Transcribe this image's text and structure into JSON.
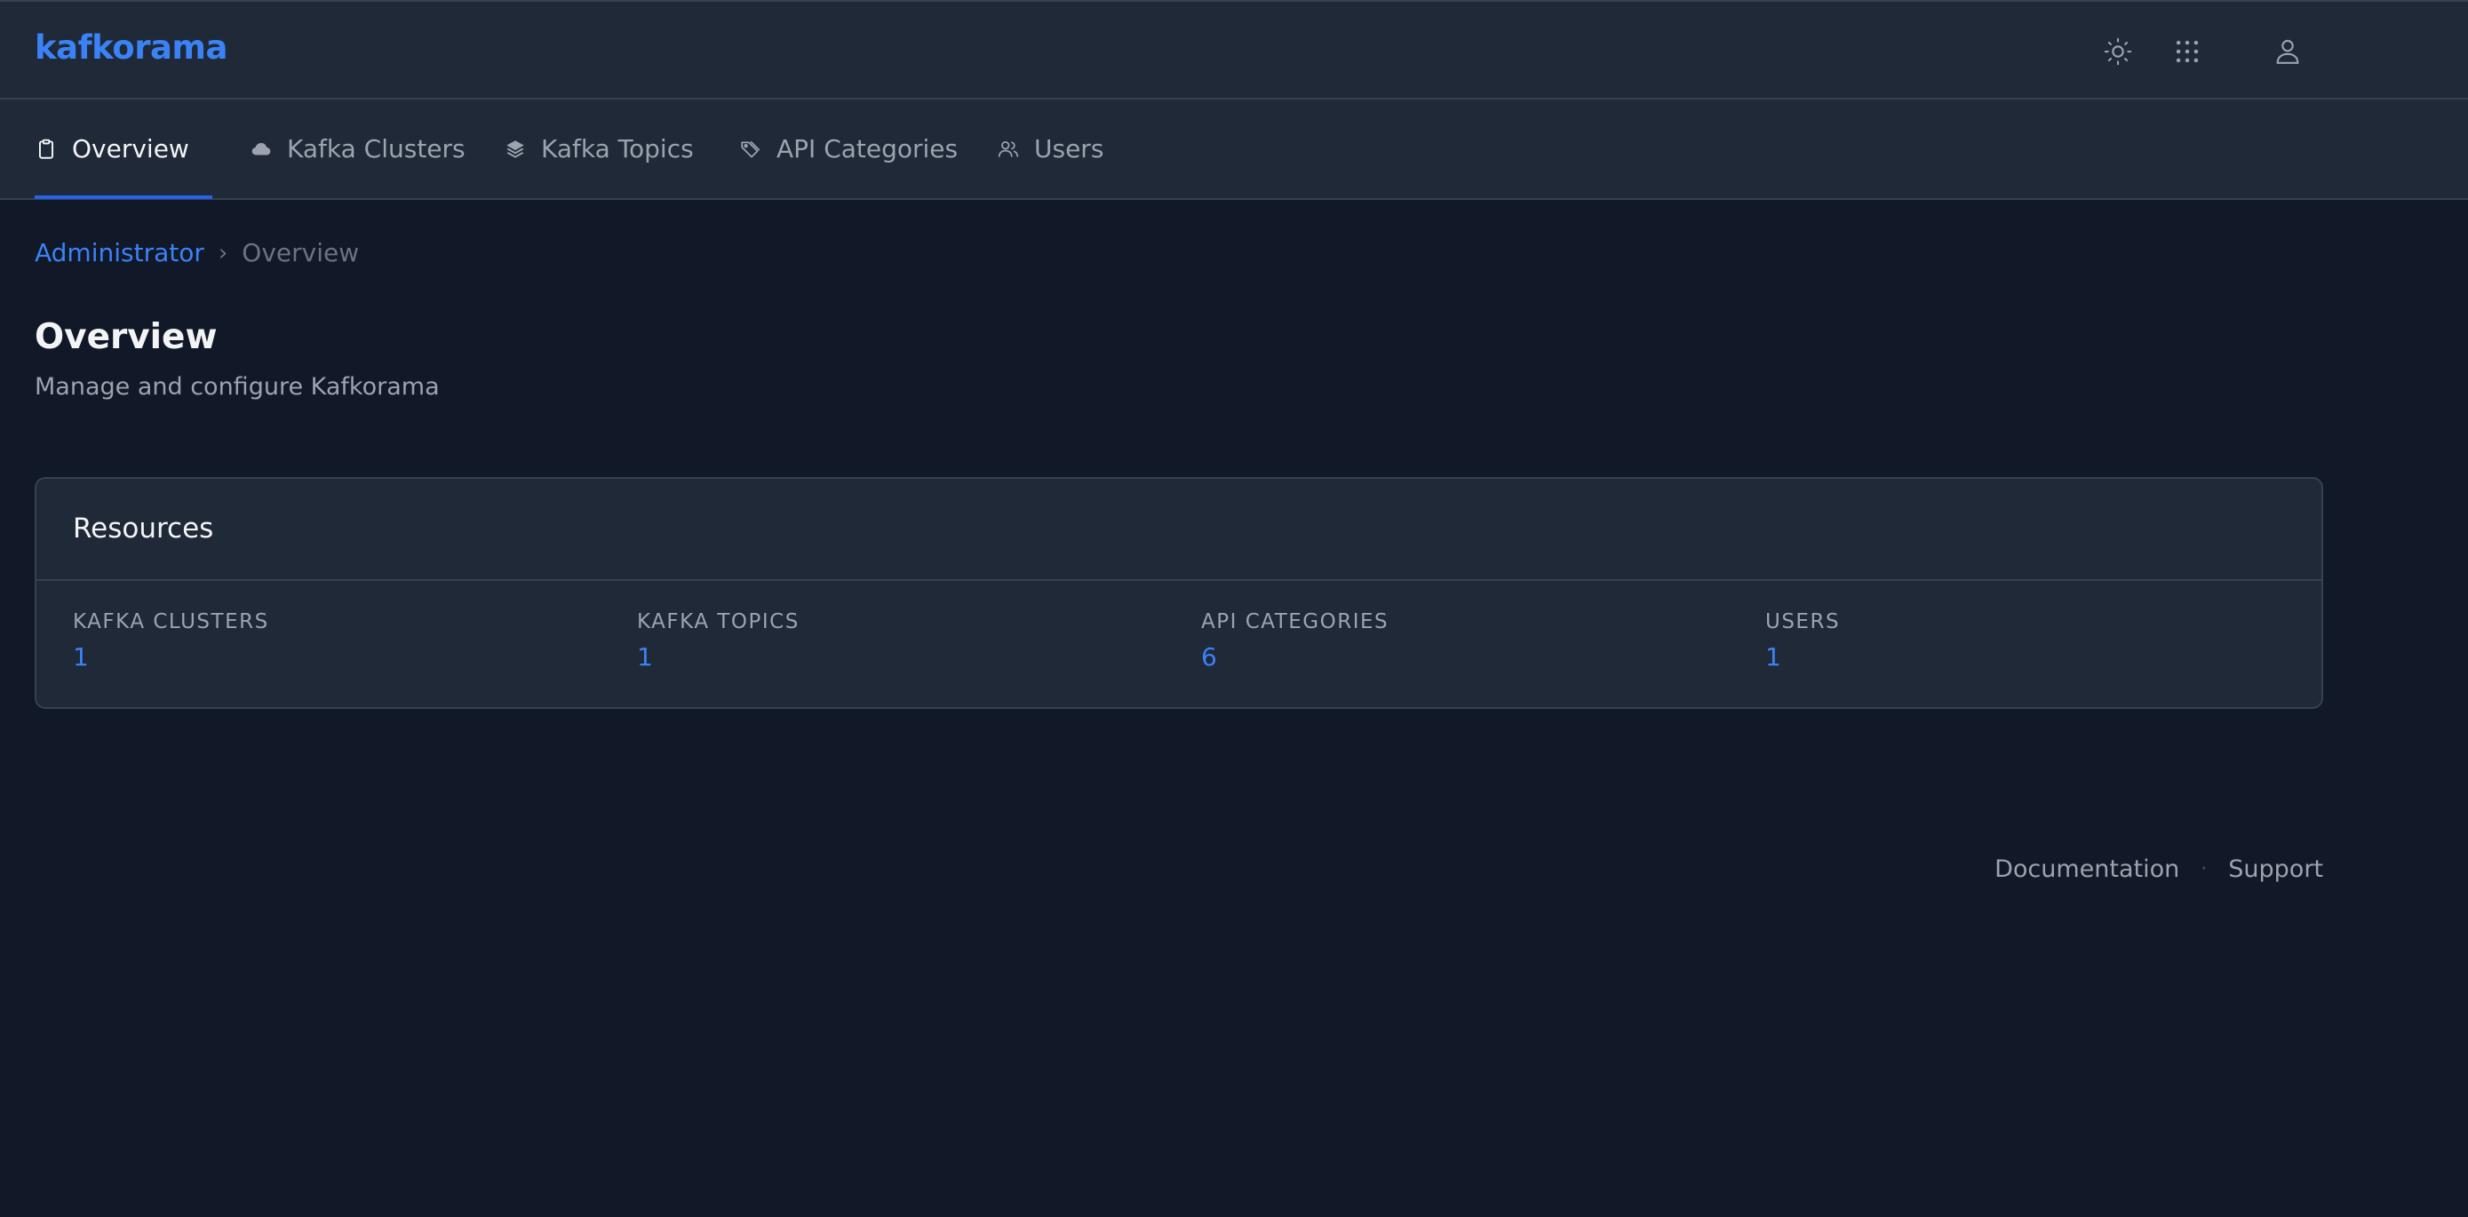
{
  "app": {
    "logo": "kafkorama"
  },
  "header_icons": [
    {
      "name": "sun-icon"
    },
    {
      "name": "grid-dots-icon"
    },
    {
      "name": "user-icon"
    }
  ],
  "nav": {
    "tabs": [
      {
        "label": "Overview",
        "icon": "clipboard-icon",
        "active": true
      },
      {
        "label": "Kafka Clusters",
        "icon": "cloud-icon",
        "active": false
      },
      {
        "label": "Kafka Topics",
        "icon": "layers-icon",
        "active": false
      },
      {
        "label": "API Categories",
        "icon": "tags-icon",
        "active": false
      },
      {
        "label": "Users",
        "icon": "users-icon",
        "active": false
      }
    ]
  },
  "breadcrumb": {
    "root": "Administrator",
    "separator": "›",
    "current": "Overview"
  },
  "page": {
    "title": "Overview",
    "subtitle": "Manage and configure Kafkorama"
  },
  "resources": {
    "title": "Resources",
    "stats": [
      {
        "label": "KAFKA CLUSTERS",
        "value": "1"
      },
      {
        "label": "KAFKA TOPICS",
        "value": "1"
      },
      {
        "label": "API CATEGORIES",
        "value": "6"
      },
      {
        "label": "USERS",
        "value": "1"
      }
    ]
  },
  "footer": {
    "documentation": "Documentation",
    "separator": "·",
    "support": "Support"
  },
  "colors": {
    "background": "#111827",
    "surface": "#1f2937",
    "accent": "#3b82f6",
    "border": "#374151"
  }
}
